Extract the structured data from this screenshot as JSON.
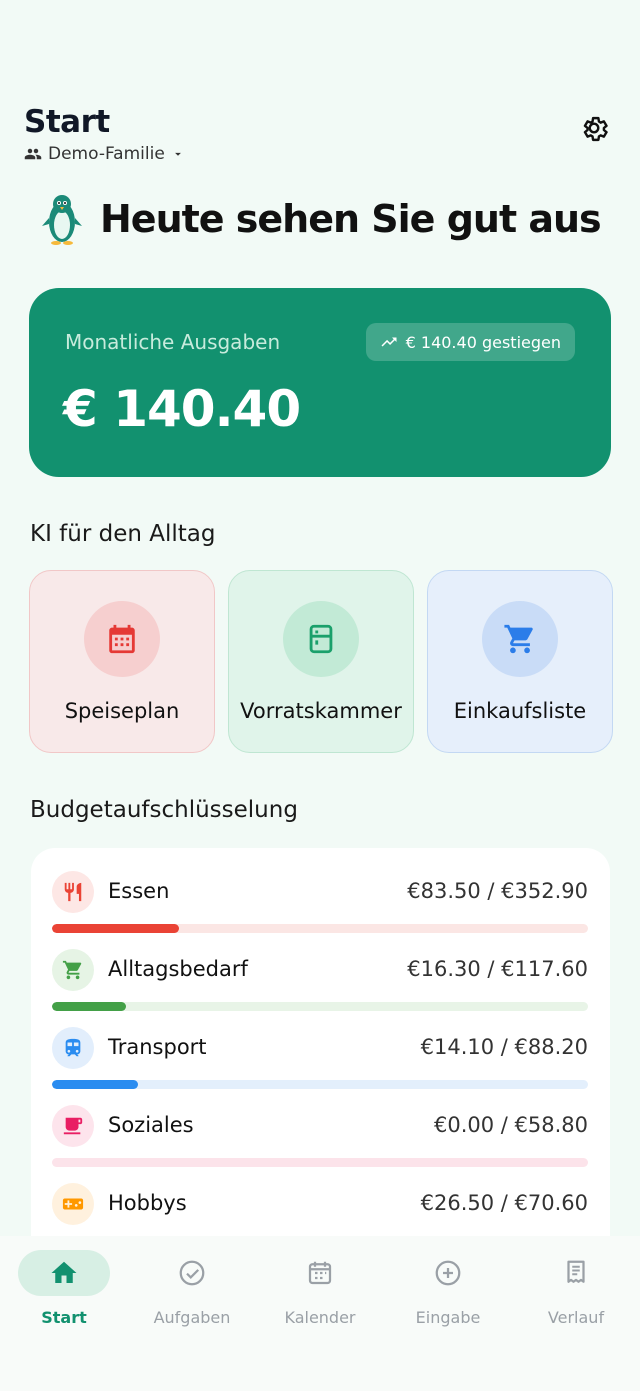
{
  "header": {
    "title": "Start",
    "family": "Demo-Familie"
  },
  "greeting": "Heute sehen Sie gut aus",
  "spending": {
    "label": "Monatliche Ausgaben",
    "value": "€ 140.40",
    "trend": "€ 140.40 gestiegen"
  },
  "ai_section": {
    "title": "KI für den Alltag",
    "cards": [
      {
        "label": "Speiseplan",
        "icon": "calendar-icon"
      },
      {
        "label": "Vorratskammer",
        "icon": "fridge-icon"
      },
      {
        "label": "Einkaufsliste",
        "icon": "cart-icon"
      }
    ]
  },
  "budget": {
    "title": "Budgetaufschlüsselung",
    "items": [
      {
        "name": "Essen",
        "amount": "€83.50 / €352.90",
        "spent": 83.5,
        "limit": 352.9,
        "color": "#ea4335",
        "track": "#fbe6e4",
        "icon_bg": "#fde7e5",
        "icon": "fork-knife-icon"
      },
      {
        "name": "Alltagsbedarf",
        "amount": "€16.30 / €117.60",
        "spent": 16.3,
        "limit": 117.6,
        "color": "#43a047",
        "track": "#e8f4e7",
        "icon_bg": "#e6f4e5",
        "icon": "cart-icon"
      },
      {
        "name": "Transport",
        "amount": "€14.10 / €88.20",
        "spent": 14.1,
        "limit": 88.2,
        "color": "#2a8cf0",
        "track": "#e3effc",
        "icon_bg": "#e2eefc",
        "icon": "train-icon"
      },
      {
        "name": "Soziales",
        "amount": "€0.00 / €58.80",
        "spent": 0.0,
        "limit": 58.8,
        "color": "#e91e63",
        "track": "#fce3ea",
        "icon_bg": "#fde4ec",
        "icon": "cup-icon"
      },
      {
        "name": "Hobbys",
        "amount": "€26.50 / €70.60",
        "spent": 26.5,
        "limit": 70.6,
        "color": "#ff9800",
        "track": "#fff0da",
        "icon_bg": "#fff1de",
        "icon": "gamepad-icon"
      }
    ]
  },
  "nav": {
    "items": [
      {
        "label": "Start",
        "icon": "home-icon",
        "active": true
      },
      {
        "label": "Aufgaben",
        "icon": "check-circle-icon",
        "active": false
      },
      {
        "label": "Kalender",
        "icon": "calendar-icon",
        "active": false
      },
      {
        "label": "Eingabe",
        "icon": "plus-circle-icon",
        "active": false
      },
      {
        "label": "Verlauf",
        "icon": "receipt-icon",
        "active": false
      }
    ]
  },
  "colors": {
    "accent": "#12916f",
    "background": "#f2faf6"
  }
}
